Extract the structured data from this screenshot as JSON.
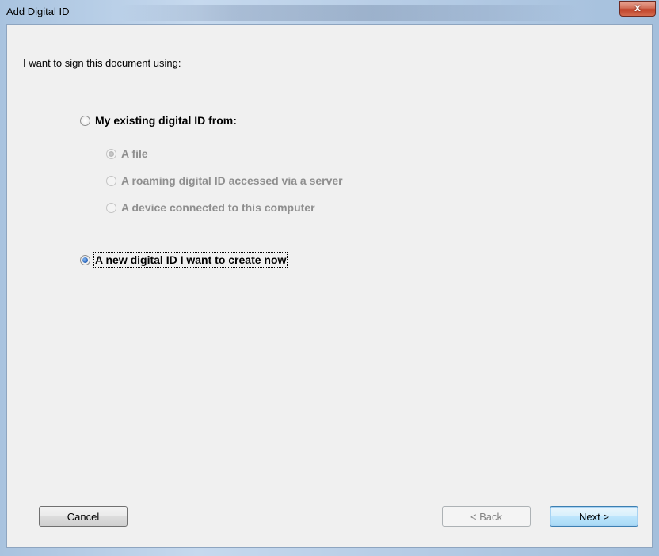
{
  "window": {
    "title": "Add Digital ID",
    "close_label": "x"
  },
  "prompt": "I want to sign this document using:",
  "options": {
    "existing": "My existing digital ID from:",
    "sub": [
      "A file",
      "A roaming digital ID accessed via a server",
      "A device connected to this computer"
    ],
    "new_id": "A new digital ID I want to create now"
  },
  "selection": {
    "main": "A new digital ID I want to create now",
    "sub_default": "A file"
  },
  "buttons": {
    "cancel": "Cancel",
    "back": "< Back",
    "next": "Next >"
  }
}
